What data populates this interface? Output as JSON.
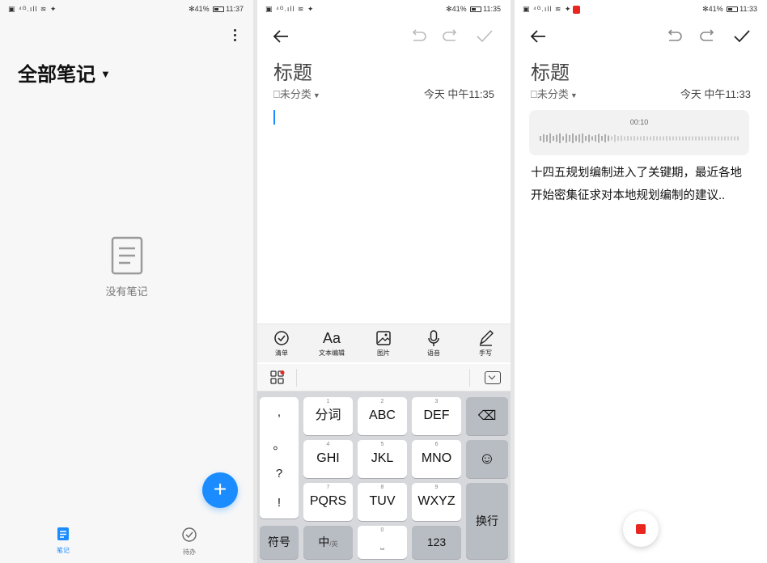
{
  "panel1": {
    "status": {
      "left": "▣ ⁴ᴳ.ıll ≋ ✦",
      "right": "✻41% ",
      "time": "11:37"
    },
    "title": "全部笔记",
    "empty_label": "没有笔记",
    "fab_label": "+",
    "tabs": [
      {
        "label": "笔记",
        "icon": "notes-icon",
        "active": true
      },
      {
        "label": "待办",
        "icon": "check-circle-icon",
        "active": false
      }
    ],
    "accent": "#1a8cff"
  },
  "panel2": {
    "status": {
      "left": "▣ ⁴ᴳ.ıll ≋ ✦",
      "right": "✻41% ",
      "time": "11:35"
    },
    "title": "标题",
    "category": "未分类",
    "date": "今天 中午11:35",
    "format_bar": [
      {
        "label": "清单",
        "icon": "checklist-icon"
      },
      {
        "label": "文本编辑",
        "icon": "text-format-icon",
        "glyph": "Aa"
      },
      {
        "label": "图片",
        "icon": "image-icon"
      },
      {
        "label": "语音",
        "icon": "microphone-icon"
      },
      {
        "label": "手写",
        "icon": "pen-icon"
      }
    ],
    "keyboard": {
      "punct": [
        ",",
        "。",
        "?",
        "!"
      ],
      "rows": [
        [
          {
            "num": "1",
            "label": "分词"
          },
          {
            "num": "2",
            "label": "ABC"
          },
          {
            "num": "3",
            "label": "DEF"
          }
        ],
        [
          {
            "num": "4",
            "label": "GHI"
          },
          {
            "num": "5",
            "label": "JKL"
          },
          {
            "num": "6",
            "label": "MNO"
          }
        ],
        [
          {
            "num": "7",
            "label": "PQRS"
          },
          {
            "num": "8",
            "label": "TUV"
          },
          {
            "num": "9",
            "label": "WXYZ"
          }
        ]
      ],
      "backspace": "⌫",
      "emoji": "☺",
      "enter": "换行",
      "symbols": "符号",
      "lang": "中",
      "lang_sub": "/英",
      "space_num": "0",
      "numbers": "123"
    }
  },
  "panel3": {
    "status": {
      "left": "▣ ⁴ᴳ.ıll ≋ ✦",
      "right": "✻41% ",
      "time": "11:33"
    },
    "title": "标题",
    "category": "未分类",
    "date": "今天 中午11:33",
    "audio_time": "00:10",
    "body": "十四五规划编制进入了关键期，最近各地开始密集征求对本地规划编制的建议..",
    "stop_color": "#e8261f"
  }
}
